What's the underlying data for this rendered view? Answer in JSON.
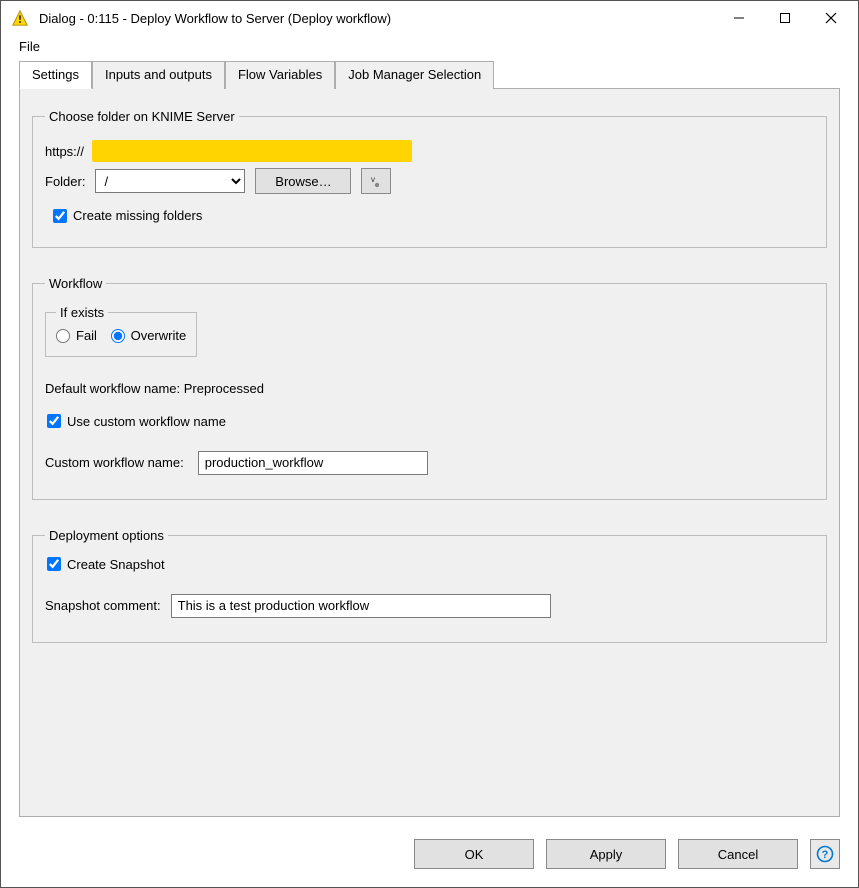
{
  "window": {
    "title": "Dialog - 0:115 - Deploy Workflow to Server (Deploy  workflow)"
  },
  "menubar": {
    "file": "File"
  },
  "tabs": [
    {
      "label": "Settings",
      "active": true
    },
    {
      "label": "Inputs and outputs",
      "active": false
    },
    {
      "label": "Flow Variables",
      "active": false
    },
    {
      "label": "Job Manager Selection",
      "active": false
    }
  ],
  "group_server": {
    "legend": "Choose folder on KNIME Server",
    "url_prefix": "https://",
    "folder_label": "Folder:",
    "folder_value": "/",
    "browse_button": "Browse…",
    "create_missing_label": "Create missing folders",
    "create_missing_checked": true
  },
  "group_workflow": {
    "legend": "Workflow",
    "if_exists_legend": "If exists",
    "fail_label": "Fail",
    "overwrite_label": "Overwrite",
    "if_exists_value": "overwrite",
    "default_name_label": "Default workflow name: Preprocessed",
    "use_custom_label": "Use custom workflow name",
    "use_custom_checked": true,
    "custom_name_label": "Custom workflow name:",
    "custom_name_value": "production_workflow"
  },
  "group_deploy": {
    "legend": "Deployment options",
    "snapshot_label": "Create Snapshot",
    "snapshot_checked": true,
    "comment_label": "Snapshot comment:",
    "comment_value": "This is a test production workflow"
  },
  "buttons": {
    "ok": "OK",
    "apply": "Apply",
    "cancel": "Cancel"
  }
}
